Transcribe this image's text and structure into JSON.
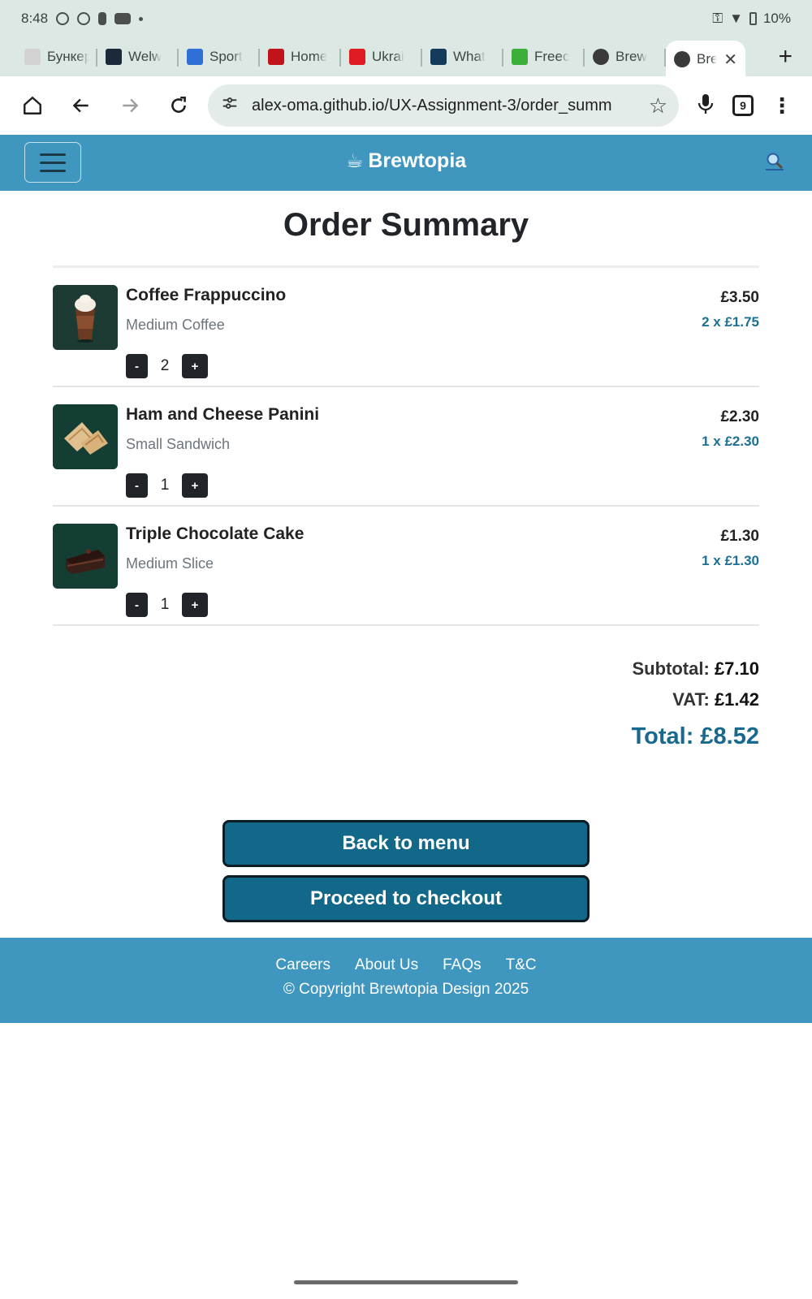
{
  "status_bar": {
    "time": "8:48",
    "battery": "10%"
  },
  "browser": {
    "tabs": [
      {
        "title": "Бункер",
        "favicon_color": "#d3d3d3"
      },
      {
        "title": "Welw",
        "favicon_color": "#1b2a3a"
      },
      {
        "title": "Sport",
        "favicon_color": "#2f6fd6"
      },
      {
        "title": "Home",
        "favicon_color": "#c0141a"
      },
      {
        "title": "Ukrai",
        "favicon_color": "#e01b24"
      },
      {
        "title": "What",
        "favicon_color": "#153b5c"
      },
      {
        "title": "Freec",
        "favicon_color": "#3cae3a"
      },
      {
        "title": "Brew",
        "favicon_color": "#3a3a3a"
      },
      {
        "title": "Bre",
        "favicon_color": "#3a3a3a",
        "active": true
      }
    ],
    "url": "alex-oma.github.io/UX-Assignment-3/order_summ",
    "tab_count": "9"
  },
  "header": {
    "brand": "Brewtopia",
    "brand_icon": "☕"
  },
  "main": {
    "title": "Order Summary",
    "items": [
      {
        "name": "Coffee Frappuccino",
        "variant": "Medium Coffee",
        "qty": "2",
        "total": "£3.50",
        "unit": "2 x £1.75",
        "image": "frappuccino"
      },
      {
        "name": "Ham and Cheese Panini",
        "variant": "Small Sandwich",
        "qty": "1",
        "total": "£2.30",
        "unit": "1 x £2.30",
        "image": "panini"
      },
      {
        "name": "Triple Chocolate Cake",
        "variant": "Medium Slice",
        "qty": "1",
        "total": "£1.30",
        "unit": "1 x £1.30",
        "image": "cake"
      }
    ],
    "minus_label": "-",
    "plus_label": "+",
    "subtotal_label": "Subtotal:",
    "subtotal_value": "£7.10",
    "vat_label": "VAT:",
    "vat_value": "£1.42",
    "total_label": "Total:",
    "total_value": "£8.52",
    "back_button": "Back to menu",
    "checkout_button": "Proceed to checkout"
  },
  "footer": {
    "links": [
      "Careers",
      "About Us",
      "FAQs",
      "T&C"
    ],
    "copyright": "© Copyright Brewtopia Design 2025"
  },
  "colors": {
    "header_bg": "#3f96bf",
    "button_bg": "#126889",
    "total_color": "#19698f",
    "unit_price_color": "#1e6f94"
  }
}
